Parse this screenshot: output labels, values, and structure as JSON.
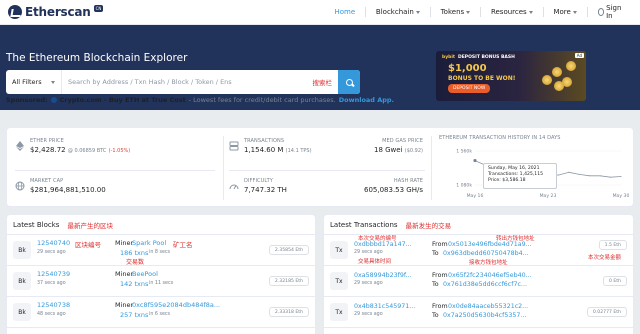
{
  "brand": {
    "name": "Etherscan",
    "badge": "CN"
  },
  "nav": {
    "home": "Home",
    "blockchain": "Blockchain",
    "tokens": "Tokens",
    "resources": "Resources",
    "more": "More",
    "signin": "Sign In"
  },
  "hero": {
    "title": "The Ethereum Blockchain Explorer",
    "filter": "All Filters",
    "search_placeholder": "Search by Address / Txn Hash / Block / Token / Ens",
    "search_annotation": "搜索栏"
  },
  "ad": {
    "label": "Ad",
    "brand": "bybit",
    "title": "DEPOSIT BONUS BASH",
    "amount": "$1,000",
    "subtitle": "BONUS TO BE WON!",
    "button": "DEPOSIT NOW"
  },
  "sponsor": {
    "label": "Sponsored:",
    "name": "Crypto.com - Buy ETH at True Cost",
    "desc": "- Lowest fees for credit/debit card purchases.",
    "link": "Download App."
  },
  "stats": {
    "ether_price": {
      "label": "ETHER PRICE",
      "value": "$2,428.72",
      "sub": "@ 0.06859 BTC",
      "change": "(-1.05%)"
    },
    "market_cap": {
      "label": "MARKET CAP",
      "value": "$281,964,881,510.00"
    },
    "transactions": {
      "label": "TRANSACTIONS",
      "value": "1,154.60 M",
      "sub": "(14.1 TPS)"
    },
    "difficulty": {
      "label": "DIFFICULTY",
      "value": "7,747.32 TH"
    },
    "gas_price": {
      "label": "MED GAS PRICE",
      "value": "18 Gwei",
      "sub": "($0.92)"
    },
    "hash_rate": {
      "label": "HASH RATE",
      "value": "605,083.53 GH/s"
    }
  },
  "chart_data": {
    "type": "line",
    "title": "ETHEREUM TRANSACTION HISTORY IN 14 DAYS",
    "x": [
      "May 16",
      "May 17",
      "May 18",
      "May 19",
      "May 20",
      "May 21",
      "May 22",
      "May 23",
      "May 24",
      "May 25",
      "May 26",
      "May 27",
      "May 28",
      "May 29",
      "May 30"
    ],
    "values": [
      1425115,
      1360000,
      1330000,
      1320000,
      1310000,
      1240000,
      1180000,
      1240000,
      1220000,
      1260000,
      1230000,
      1210000,
      1210000,
      1190000,
      1200000
    ],
    "xticks": [
      "May 16",
      "May 23",
      "May 30"
    ],
    "yticks": [
      "1 560k",
      "1 080k"
    ],
    "ylim": [
      1080000,
      1560000
    ],
    "tooltip": {
      "date": "Sunday, May 16, 2021",
      "transactions": "Transactions: 1,425,115",
      "price": "Price: $3,586.18"
    }
  },
  "latest_blocks": {
    "title": "Latest Blocks",
    "annotation": "最新产生的区块",
    "rows": [
      {
        "badge": "Bk",
        "number": "12540740",
        "age": "29 secs ago",
        "miner_label": "Miner",
        "miner": "Spark Pool",
        "txns": "186 txns",
        "time": "in 8 secs",
        "reward": "2.35854 Eth"
      },
      {
        "badge": "Bk",
        "number": "12540739",
        "age": "37 secs ago",
        "miner_label": "Miner",
        "miner": "BeePool",
        "txns": "142 txns",
        "time": "in 11 secs",
        "reward": "2.32185 Eth"
      },
      {
        "badge": "Bk",
        "number": "12540738",
        "age": "48 secs ago",
        "miner_label": "Miner",
        "miner": "0xc8f595e2084db484f8a...",
        "txns": "257 txns",
        "time": "in 6 secs",
        "reward": "2.33318 Eth"
      }
    ],
    "ann_block_number": "区块编号",
    "ann_miner": "矿工名",
    "ann_txn_count": "交易数"
  },
  "latest_txns": {
    "title": "Latest Transactions",
    "annotation": "最新发生的交易",
    "rows": [
      {
        "badge": "Tx",
        "hash": "0xdbbbd17a147...",
        "age": "29 secs ago",
        "from_label": "From",
        "from": "0x5013e496fbde4d71a9...",
        "to_label": "To",
        "to": "0x963dbedd60750478b4...",
        "amount": "1.5 Eth"
      },
      {
        "badge": "Tx",
        "hash": "0xa58994b23f9f...",
        "age": "29 secs ago",
        "from_label": "From",
        "from": "0x65f2fc234046ef5eb40...",
        "to_label": "To",
        "to": "0x761d38e5dd6ccf6cf7c...",
        "amount": "0 Eth"
      },
      {
        "badge": "Tx",
        "hash": "0x4b831c545971...",
        "age": "29 secs ago",
        "from_label": "From",
        "from": "0x0de84aaceb55321c2...",
        "to_label": "To",
        "to": "0x7a250d5630b4cf5357...",
        "amount": "0.02777 Eth"
      }
    ],
    "ann_txn_hash": "本次交易的编号",
    "ann_txn_time": "交易具体时间",
    "ann_from": "转出方钱包地址",
    "ann_to": "接收方钱包地址",
    "ann_amount": "本次交易金额"
  }
}
